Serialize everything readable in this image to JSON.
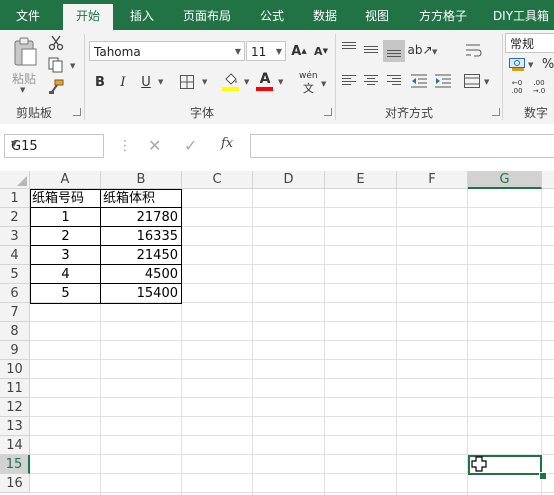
{
  "tabs": [
    "文件",
    "开始",
    "插入",
    "页面布局",
    "公式",
    "数据",
    "视图",
    "方方格子",
    "DIY工具箱"
  ],
  "active_tab": "开始",
  "ribbon": {
    "clipboard": {
      "label": "剪贴板",
      "paste_label": "粘贴"
    },
    "font": {
      "label": "字体",
      "font_name": "Tahoma",
      "font_size": "11",
      "bold": "B",
      "italic": "I",
      "underline": "U",
      "wen_label": "wén",
      "wen_char": "文"
    },
    "alignment": {
      "label": "对齐方式"
    },
    "number": {
      "label": "数字",
      "format": "常规"
    }
  },
  "formula_bar": {
    "name_box": "G15",
    "fx": "fx",
    "formula": ""
  },
  "columns": [
    "A",
    "B",
    "C",
    "D",
    "E",
    "F",
    "G"
  ],
  "selected_column": "G",
  "rows": [
    "1",
    "2",
    "3",
    "4",
    "5",
    "6",
    "7",
    "8",
    "9",
    "10",
    "11",
    "12",
    "13",
    "14",
    "15",
    "16"
  ],
  "selected_row": "15",
  "table": {
    "header": [
      "纸箱号码",
      "纸箱体积"
    ],
    "data": [
      [
        "1",
        "21780"
      ],
      [
        "2",
        "16335"
      ],
      [
        "3",
        "21450"
      ],
      [
        "4",
        "4500"
      ],
      [
        "5",
        "15400"
      ]
    ]
  },
  "colors": {
    "accent": "#217346",
    "ribbon_bg": "#f3f3f3"
  }
}
